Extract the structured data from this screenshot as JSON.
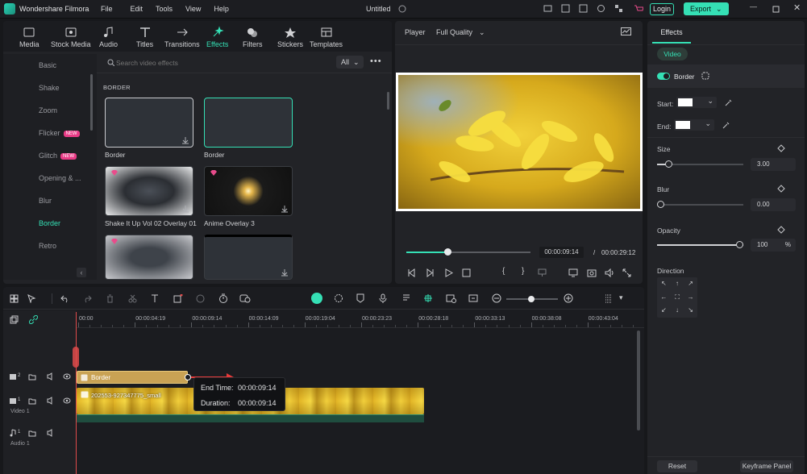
{
  "app": {
    "name": "Wondershare Filmora",
    "doc": "Untitled",
    "menus": [
      "File",
      "Edit",
      "Tools",
      "View",
      "Help"
    ],
    "login": "Login",
    "export": "Export"
  },
  "toolbar": {
    "items": [
      "Media",
      "Stock Media",
      "Audio",
      "Titles",
      "Transitions",
      "Effects",
      "Filters",
      "Stickers",
      "Templates"
    ],
    "active_index": 5
  },
  "sidebar": {
    "items": [
      {
        "label": "Basic"
      },
      {
        "label": "Shake"
      },
      {
        "label": "Zoom"
      },
      {
        "label": "Flicker",
        "badge": "NEW"
      },
      {
        "label": "Glitch",
        "badge": "NEW"
      },
      {
        "label": "Opening & ..."
      },
      {
        "label": "Blur"
      },
      {
        "label": "Border",
        "active": true
      },
      {
        "label": "Retro"
      }
    ]
  },
  "search": {
    "placeholder": "Search video effects",
    "filter": "All"
  },
  "section_title": "BORDER",
  "effects": [
    {
      "label": "Border"
    },
    {
      "label": "Border"
    },
    {
      "label": "Shake It Up Vol 02 Overlay 01"
    },
    {
      "label": "Anime Overlay 3"
    },
    {
      "label": ""
    },
    {
      "label": ""
    }
  ],
  "player": {
    "label": "Player",
    "quality": "Full Quality",
    "current_time": "00:00:09:14",
    "separator": "/",
    "total_time": "00:00:29:12",
    "progress": 0.33
  },
  "inspector": {
    "tab": "Effects",
    "subtab": "Video",
    "effect_name": "Border",
    "start_label": "Start:",
    "end_label": "End:",
    "size_label": "Size",
    "size_value": "3.00",
    "blur_label": "Blur",
    "blur_value": "0.00",
    "opacity_label": "Opacity",
    "opacity_value": "100",
    "opacity_unit": "%",
    "direction_label": "Direction",
    "reset": "Reset",
    "keyframe": "Keyframe Panel"
  },
  "timeline": {
    "ruler": [
      "00:00",
      "00:00:04:19",
      "00:00:09:14",
      "00:00:14:09",
      "00:00:19:04",
      "00:00:23:23",
      "00:00:28:18",
      "00:00:33:13",
      "00:00:38:08",
      "00:00:43:04"
    ],
    "track2_num": "2",
    "track1_num": "1",
    "track1_name": "Video 1",
    "audio1_num": "1",
    "audio1_name": "Audio 1",
    "effect_clip": "Border",
    "video_clip": "202553-927347775_small",
    "tooltip_end_label": "End Time:",
    "tooltip_end": "00:00:09:14",
    "tooltip_dur_label": "Duration:",
    "tooltip_dur": "00:00:09:14"
  },
  "colors": {
    "accent": "#35e0b5",
    "effect_clip": "#c9a254",
    "playhead": "#e04b4b"
  }
}
